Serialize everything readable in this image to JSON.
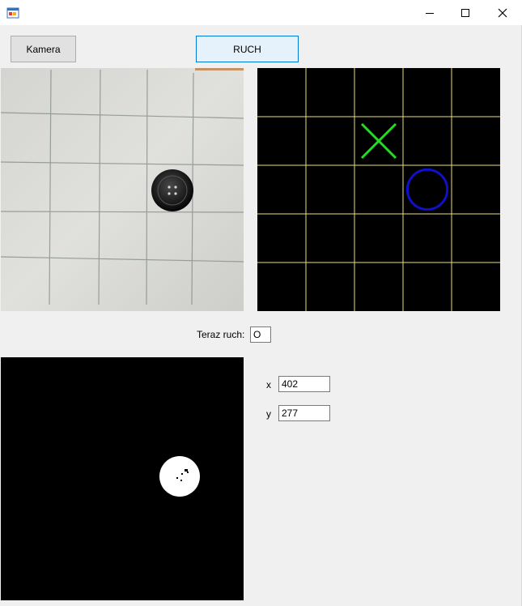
{
  "window": {
    "icons": {
      "app": "app-icon",
      "minimize": "minimize-icon",
      "maximize": "maximize-icon",
      "close": "close-icon"
    }
  },
  "toolbar": {
    "camera_label": "Kamera",
    "move_label": "RUCH"
  },
  "board": {
    "grid_color": "#e6e07a",
    "x_color": "#22dd22",
    "o_color": "#1010c8",
    "marks": [
      {
        "symbol": "X",
        "row": 1,
        "col": 2
      },
      {
        "symbol": "O",
        "row": 2,
        "col": 3
      }
    ]
  },
  "status": {
    "turn_label": "Teraz ruch:",
    "turn_value": "O"
  },
  "coords": {
    "x_label": "x",
    "x_value": "402",
    "y_label": "y",
    "y_value": "277"
  }
}
